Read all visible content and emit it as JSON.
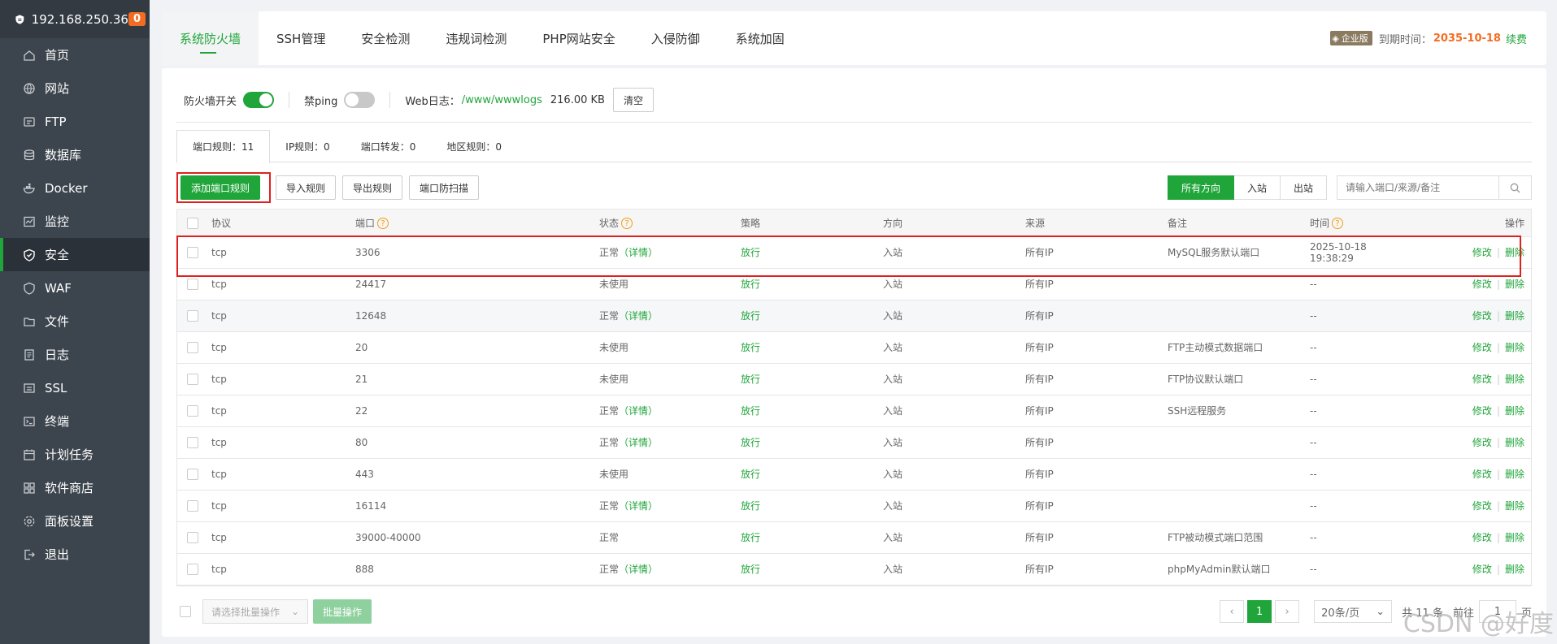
{
  "sidebar": {
    "ip": "192.168.250.36",
    "badge": "0",
    "items": [
      {
        "label": "首页",
        "icon": "home-icon"
      },
      {
        "label": "网站",
        "icon": "globe-icon"
      },
      {
        "label": "FTP",
        "icon": "ftp-icon"
      },
      {
        "label": "数据库",
        "icon": "database-icon"
      },
      {
        "label": "Docker",
        "icon": "docker-icon"
      },
      {
        "label": "监控",
        "icon": "monitor-icon"
      },
      {
        "label": "安全",
        "icon": "shield-icon",
        "active": true
      },
      {
        "label": "WAF",
        "icon": "waf-icon"
      },
      {
        "label": "文件",
        "icon": "folder-icon"
      },
      {
        "label": "日志",
        "icon": "log-icon"
      },
      {
        "label": "SSL",
        "icon": "ssl-icon"
      },
      {
        "label": "终端",
        "icon": "terminal-icon"
      },
      {
        "label": "计划任务",
        "icon": "calendar-icon"
      },
      {
        "label": "软件商店",
        "icon": "apps-icon"
      },
      {
        "label": "面板设置",
        "icon": "settings-icon"
      },
      {
        "label": "退出",
        "icon": "logout-icon"
      }
    ]
  },
  "topbar": {
    "tabs": [
      "系统防火墙",
      "SSH管理",
      "安全检测",
      "违规词检测",
      "PHP网站安全",
      "入侵防御",
      "系统加固"
    ],
    "enterprise_label": "企业版",
    "expire_label": "到期时间：",
    "expire_date": "2035-10-18",
    "renew_label": "续费"
  },
  "firewall": {
    "switch_label": "防火墙开关",
    "ping_label": "禁ping",
    "weblog_label": "Web日志：",
    "weblog_path": "/www/wwwlogs",
    "weblog_size": "216.00 KB",
    "clear_label": "清空"
  },
  "sub_tabs": [
    "端口规则：11",
    "IP规则：0",
    "端口转发：0",
    "地区规则：0"
  ],
  "toolbar": {
    "add_label": "添加端口规则",
    "import_label": "导入规则",
    "export_label": "导出规则",
    "scan_label": "端口防扫描",
    "dir_all": "所有方向",
    "dir_in": "入站",
    "dir_out": "出站",
    "search_placeholder": "请输入端口/来源/备注"
  },
  "table": {
    "headers": {
      "protocol": "协议",
      "port": "端口",
      "status": "状态",
      "policy": "策略",
      "direction": "方向",
      "source": "来源",
      "note": "备注",
      "time": "时间",
      "ops": "操作"
    },
    "detail_label": "（详情）",
    "edit_label": "修改",
    "delete_label": "删除",
    "rows": [
      {
        "protocol": "tcp",
        "port": "3306",
        "status": "正常",
        "detail": true,
        "policy": "放行",
        "direction": "入站",
        "source": "所有IP",
        "note": "MySQL服务默认端口",
        "time": "2025-10-18 19:38:29"
      },
      {
        "protocol": "tcp",
        "port": "24417",
        "status": "未使用",
        "detail": false,
        "policy": "放行",
        "direction": "入站",
        "source": "所有IP",
        "note": "",
        "time": "--"
      },
      {
        "protocol": "tcp",
        "port": "12648",
        "status": "正常",
        "detail": true,
        "policy": "放行",
        "direction": "入站",
        "source": "所有IP",
        "note": "",
        "time": "--"
      },
      {
        "protocol": "tcp",
        "port": "20",
        "status": "未使用",
        "detail": false,
        "policy": "放行",
        "direction": "入站",
        "source": "所有IP",
        "note": "FTP主动模式数据端口",
        "time": "--"
      },
      {
        "protocol": "tcp",
        "port": "21",
        "status": "未使用",
        "detail": false,
        "policy": "放行",
        "direction": "入站",
        "source": "所有IP",
        "note": "FTP协议默认端口",
        "time": "--"
      },
      {
        "protocol": "tcp",
        "port": "22",
        "status": "正常",
        "detail": true,
        "policy": "放行",
        "direction": "入站",
        "source": "所有IP",
        "note": "SSH远程服务",
        "time": "--"
      },
      {
        "protocol": "tcp",
        "port": "80",
        "status": "正常",
        "detail": true,
        "policy": "放行",
        "direction": "入站",
        "source": "所有IP",
        "note": "",
        "time": "--"
      },
      {
        "protocol": "tcp",
        "port": "443",
        "status": "未使用",
        "detail": false,
        "policy": "放行",
        "direction": "入站",
        "source": "所有IP",
        "note": "",
        "time": "--"
      },
      {
        "protocol": "tcp",
        "port": "16114",
        "status": "正常",
        "detail": true,
        "policy": "放行",
        "direction": "入站",
        "source": "所有IP",
        "note": "",
        "time": "--"
      },
      {
        "protocol": "tcp",
        "port": "39000-40000",
        "status": "正常",
        "detail": false,
        "policy": "放行",
        "direction": "入站",
        "source": "所有IP",
        "note": "FTP被动模式端口范围",
        "time": "--"
      },
      {
        "protocol": "tcp",
        "port": "888",
        "status": "正常",
        "detail": true,
        "policy": "放行",
        "direction": "入站",
        "source": "所有IP",
        "note": "phpMyAdmin默认端口",
        "time": "--"
      }
    ]
  },
  "footer": {
    "batch_placeholder": "请选择批量操作",
    "batch_button": "批量操作",
    "current_page": "1",
    "per_page": "20条/页",
    "total": "共 11 条",
    "goto_label": "前往",
    "goto_value": "1",
    "page_suffix": "页"
  },
  "watermark": "CSDN @好度",
  "colors": {
    "accent": "#20a53a",
    "sidebar": "#3c444d",
    "highlight": "#e02020",
    "orange": "#f36c21"
  }
}
